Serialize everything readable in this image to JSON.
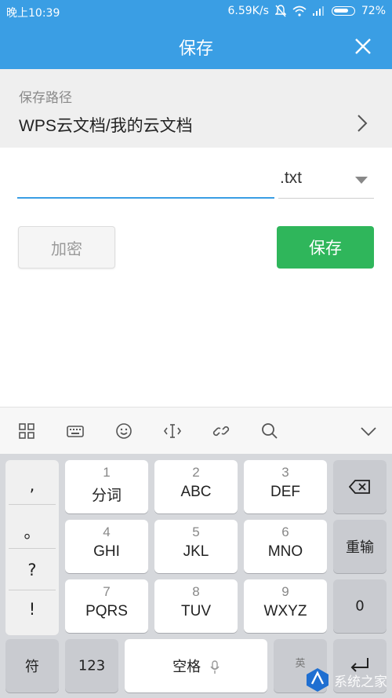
{
  "status_bar": {
    "time": "晚上10:39",
    "network_speed": "6.59K/s",
    "battery": "72%"
  },
  "header": {
    "title": "保存"
  },
  "path": {
    "label": "保存路径",
    "value": "WPS云文档/我的云文档"
  },
  "file": {
    "name_value": "",
    "extension": ".txt"
  },
  "actions": {
    "encrypt_label": "加密",
    "save_label": "保存"
  },
  "keyboard": {
    "punctuation": [
      ",",
      "。",
      "?",
      "!"
    ],
    "keys": [
      {
        "num": "1",
        "label": "分词"
      },
      {
        "num": "2",
        "label": "ABC"
      },
      {
        "num": "3",
        "label": "DEF"
      },
      {
        "num": "4",
        "label": "GHI"
      },
      {
        "num": "5",
        "label": "JKL"
      },
      {
        "num": "6",
        "label": "MNO"
      },
      {
        "num": "7",
        "label": "PQRS"
      },
      {
        "num": "8",
        "label": "TUV"
      },
      {
        "num": "9",
        "label": "WXYZ"
      }
    ],
    "redo_label": "重输",
    "zero_label": "0",
    "symbol_label": "符",
    "numbers_label": "123",
    "space_label": "空格",
    "lang_label": "英"
  },
  "watermark": {
    "text": "系统之家"
  },
  "icons": {
    "close": "close-icon",
    "chevron": "chevron-right-icon",
    "dropdown": "dropdown-caret-icon",
    "backspace": "backspace-icon",
    "enter": "enter-icon",
    "mic": "microphone-icon"
  },
  "colors": {
    "accent": "#3a9ee4",
    "save_green": "#2fb65b"
  }
}
